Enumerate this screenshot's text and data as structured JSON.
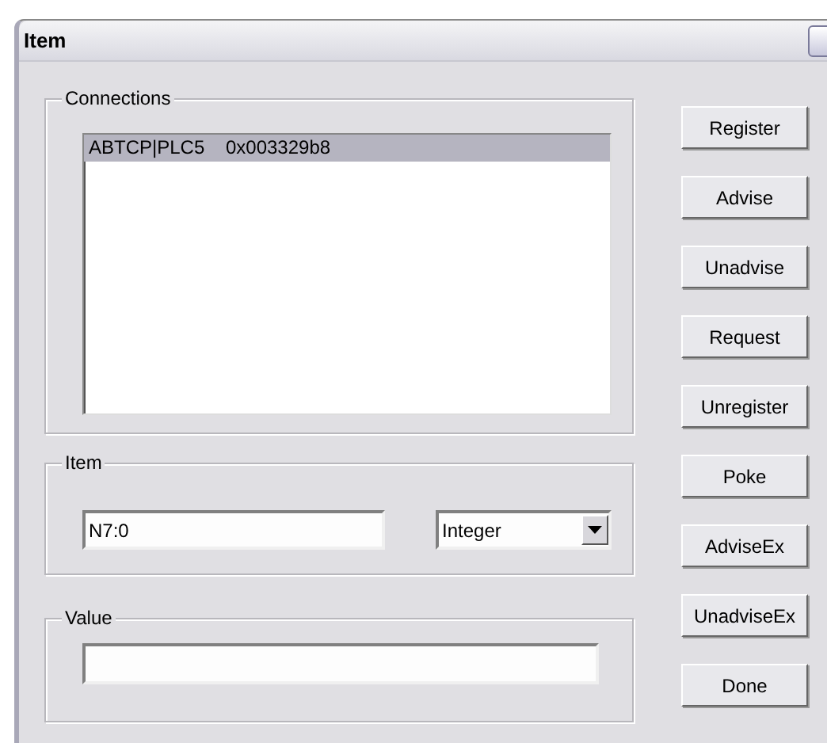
{
  "window": {
    "title": "Item"
  },
  "connections": {
    "label": "Connections",
    "items": [
      {
        "text": "ABTCP|PLC5    0x003329b8",
        "selected": true
      }
    ]
  },
  "item": {
    "label": "Item",
    "value": "N7:0",
    "type": "Integer"
  },
  "value": {
    "label": "Value"
  },
  "buttons": [
    "Register",
    "Advise",
    "Unadvise",
    "Request",
    "Unregister",
    "Poke",
    "AdviseEx",
    "UnadviseEx",
    "Done"
  ]
}
